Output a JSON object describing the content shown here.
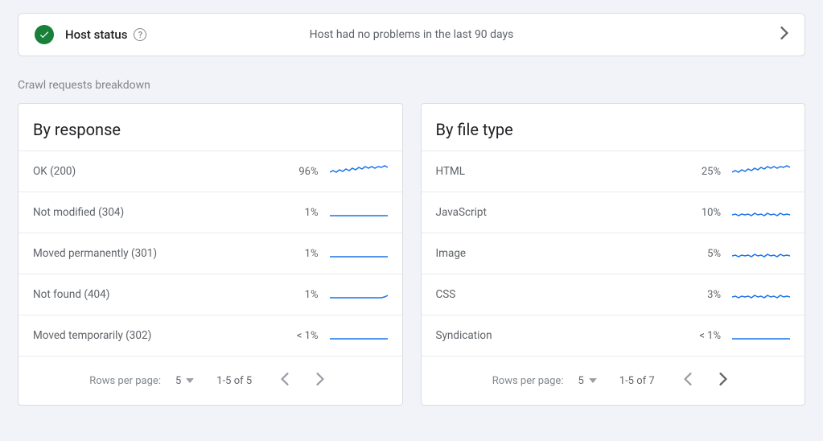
{
  "host_card": {
    "title": "Host status",
    "message": "Host had no problems in the last 90 days"
  },
  "section_label": "Crawl requests breakdown",
  "by_response": {
    "title": "By response",
    "rows": [
      {
        "label": "OK (200)",
        "pct": "96%",
        "spark": "wavy"
      },
      {
        "label": "Not modified (304)",
        "pct": "1%",
        "spark": "flat"
      },
      {
        "label": "Moved permanently (301)",
        "pct": "1%",
        "spark": "flat"
      },
      {
        "label": "Not found (404)",
        "pct": "1%",
        "spark": "flat-end"
      },
      {
        "label": "Moved temporarily (302)",
        "pct": "< 1%",
        "spark": "flat"
      }
    ],
    "pager": {
      "rows_label": "Rows per page:",
      "page_size": "5",
      "range": "1-5 of 5",
      "prev_enabled": false,
      "next_enabled": false
    }
  },
  "by_file": {
    "title": "By file type",
    "rows": [
      {
        "label": "HTML",
        "pct": "25%",
        "spark": "wavy"
      },
      {
        "label": "JavaScript",
        "pct": "10%",
        "spark": "noisy"
      },
      {
        "label": "Image",
        "pct": "5%",
        "spark": "noisy"
      },
      {
        "label": "CSS",
        "pct": "3%",
        "spark": "noisy"
      },
      {
        "label": "Syndication",
        "pct": "< 1%",
        "spark": "flat"
      }
    ],
    "pager": {
      "rows_label": "Rows per page:",
      "page_size": "5",
      "range": "1-5 of 7",
      "prev_enabled": false,
      "next_enabled": true
    }
  },
  "chart_data": [
    {
      "type": "table",
      "title": "By response",
      "categories": [
        "OK (200)",
        "Not modified (304)",
        "Moved permanently (301)",
        "Not found (404)",
        "Moved temporarily (302)"
      ],
      "values": [
        96,
        1,
        1,
        1,
        0.5
      ]
    },
    {
      "type": "table",
      "title": "By file type",
      "categories": [
        "HTML",
        "JavaScript",
        "Image",
        "CSS",
        "Syndication"
      ],
      "values": [
        25,
        10,
        5,
        3,
        0.5
      ]
    }
  ]
}
